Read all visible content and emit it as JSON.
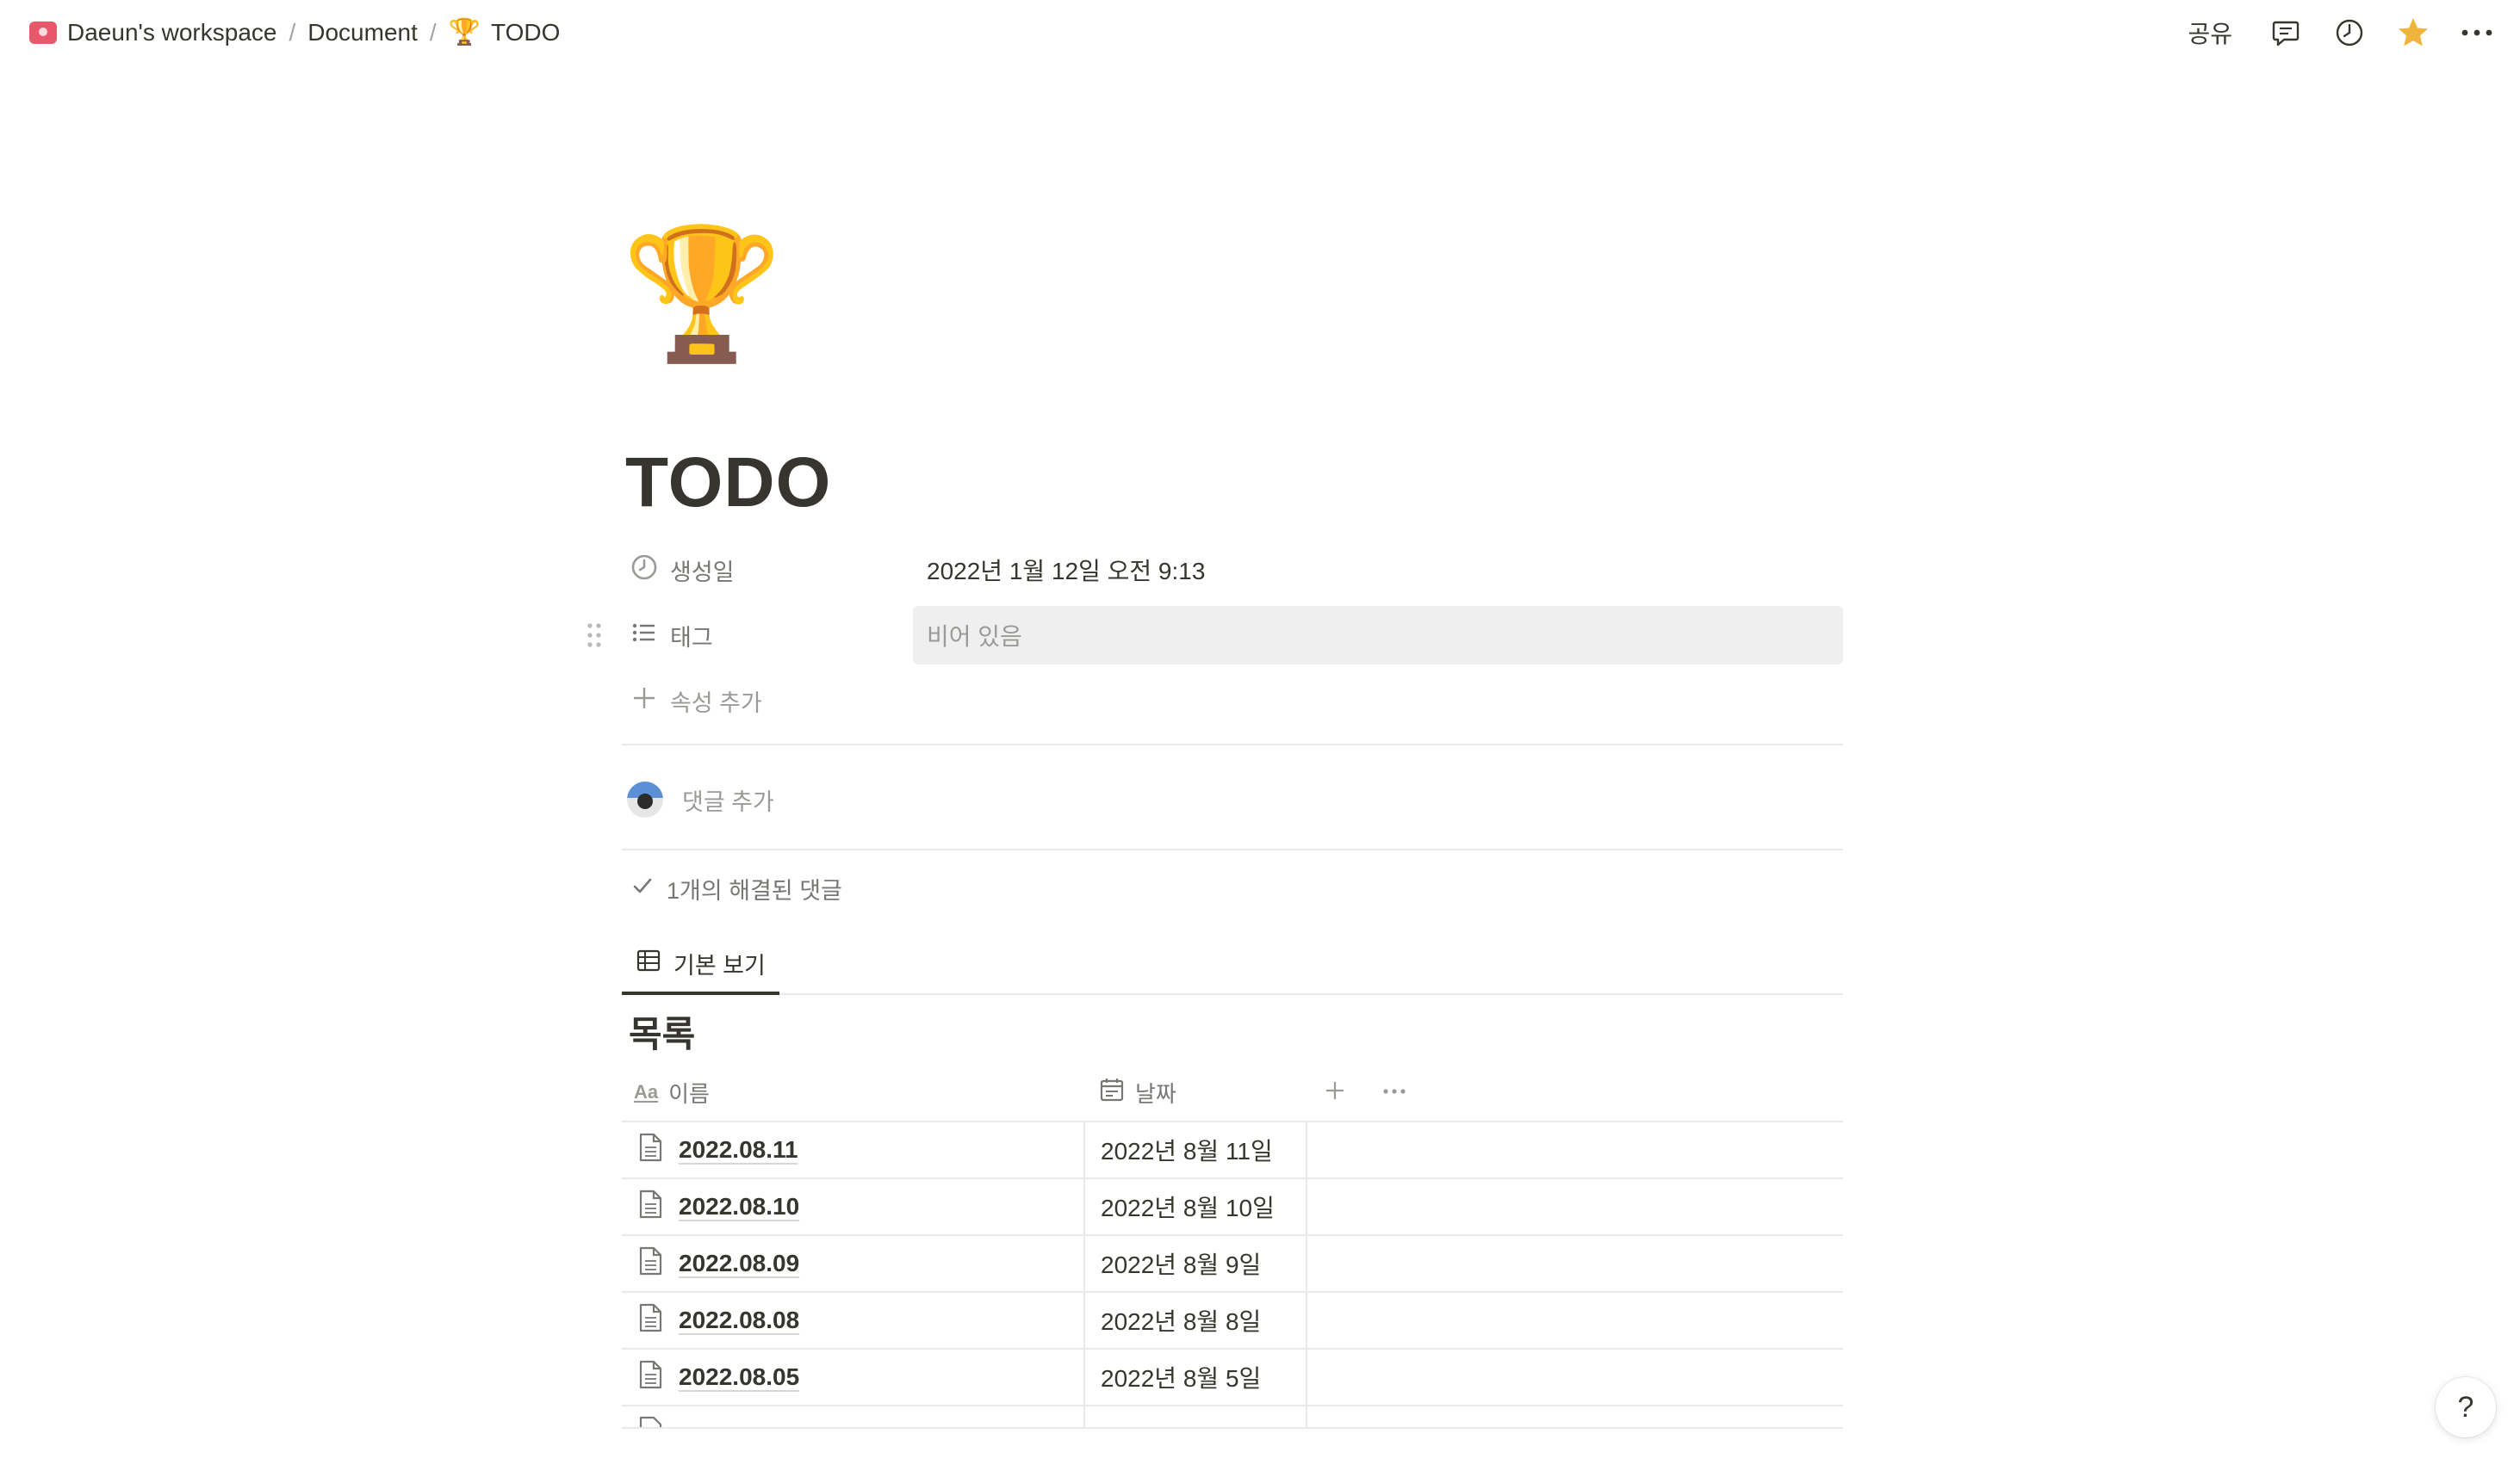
{
  "breadcrumb": {
    "workspace": "Daeun's workspace",
    "separator": "/",
    "parent": "Document",
    "current_icon": "🏆",
    "current": "TODO"
  },
  "topbar": {
    "share_label": "공유",
    "icons": [
      "comments-icon",
      "history-icon",
      "favorite-star-icon",
      "more-icon"
    ],
    "star_color": "#f0b43c"
  },
  "page": {
    "icon": "🏆",
    "title": "TODO"
  },
  "properties": {
    "created": {
      "icon": "clock-icon",
      "label": "생성일",
      "value": "2022년 1월 12일 오전 9:13"
    },
    "tags": {
      "icon": "list-icon",
      "label": "태그",
      "value": "비어 있음"
    },
    "add_property_label": "속성 추가"
  },
  "comments": {
    "add_placeholder": "댓글 추가",
    "resolved_label": "1개의 해결된 댓글"
  },
  "views": {
    "active_tab": "기본 보기"
  },
  "database": {
    "title": "목록",
    "columns": {
      "name": {
        "icon": "Aa",
        "label": "이름"
      },
      "date": {
        "icon": "calendar-icon",
        "label": "날짜"
      }
    },
    "rows": [
      {
        "name": "2022.08.11",
        "date": "2022년 8월 11일"
      },
      {
        "name": "2022.08.10",
        "date": "2022년 8월 10일"
      },
      {
        "name": "2022.08.09",
        "date": "2022년 8월 9일"
      },
      {
        "name": "2022.08.08",
        "date": "2022년 8월 8일"
      },
      {
        "name": "2022.08.05",
        "date": "2022년 8월 5일"
      }
    ]
  },
  "help": {
    "label": "?"
  }
}
